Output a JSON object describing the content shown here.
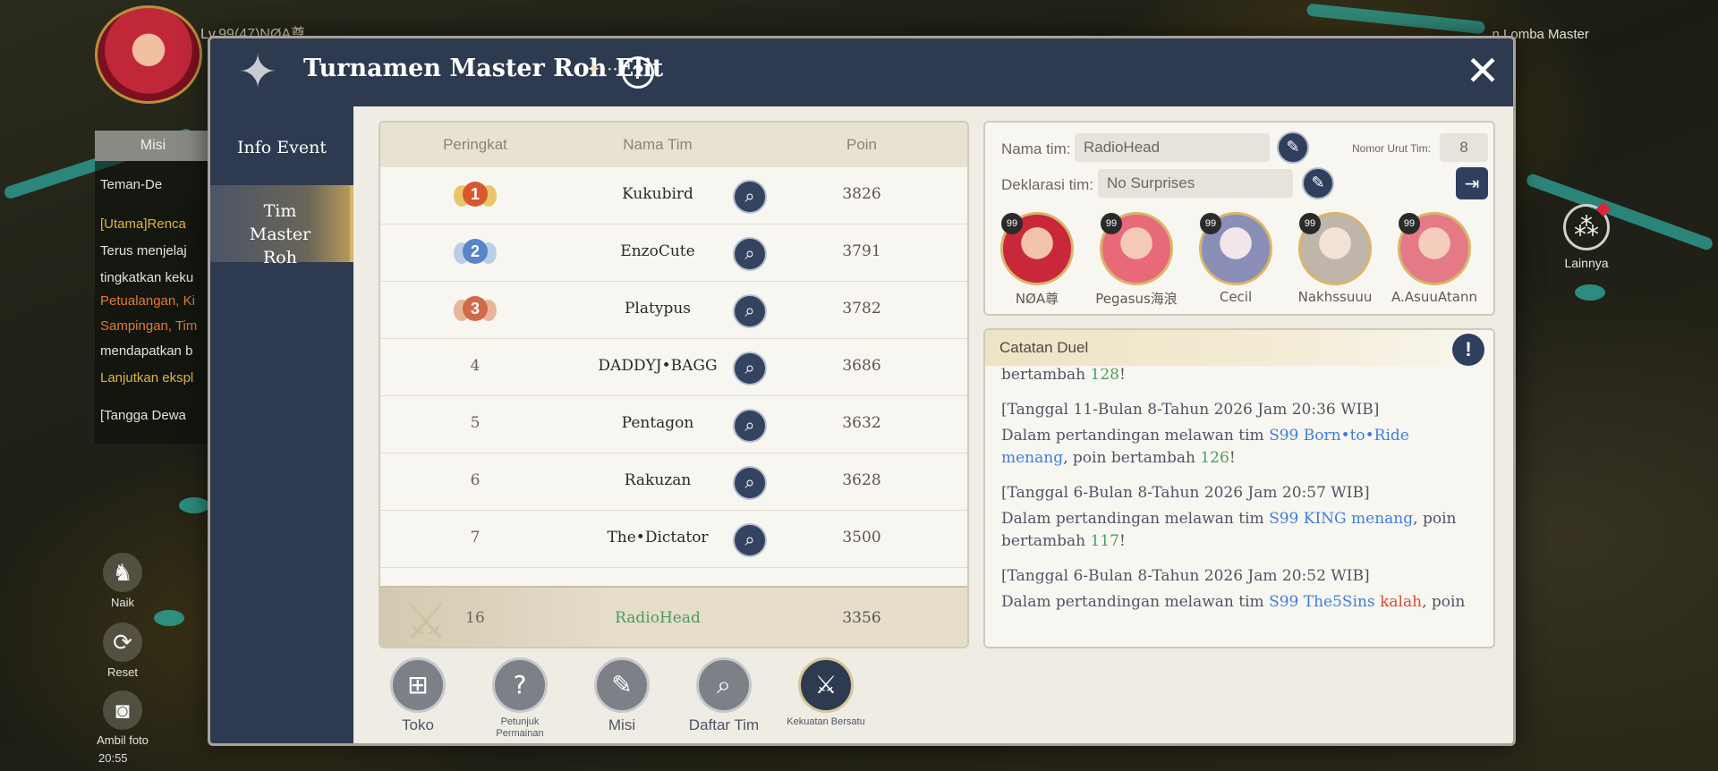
{
  "hud": {
    "level_text": "Lv.99(47)NØA尊",
    "tab_label": "Misi",
    "lines": [
      {
        "text": "Teman-De",
        "style": ""
      },
      {
        "text": "[Utama]Renca",
        "style": "gold"
      },
      {
        "text": "Terus menjelaj",
        "style": ""
      },
      {
        "text": "tingkatkan keku",
        "style": ""
      },
      {
        "text": "Petualangan, Ki",
        "style": "orange"
      },
      {
        "text": "Sampingan, Tim",
        "style": "orange"
      },
      {
        "text": "mendapatkan b",
        "style": ""
      },
      {
        "text": "Lanjutkan ekspl",
        "style": "gold"
      },
      {
        "text": "[Tangga Dewa",
        "style": ""
      }
    ],
    "side_buttons": [
      {
        "label": "Naik",
        "icon": "horse-icon"
      },
      {
        "label": "Reset",
        "icon": "camera-reset-icon"
      },
      {
        "label": "Ambil foto",
        "icon": "camera-icon"
      }
    ],
    "time": "20:55",
    "top_right": "...n Lomba Master",
    "lainnya_label": "Lainnya"
  },
  "dialog": {
    "title": "Turnamen Master Roh Elit",
    "nav": [
      {
        "label": "Info Event",
        "active": false
      },
      {
        "label": "Tim Master Roh",
        "active": true
      }
    ],
    "ranking": {
      "headers": {
        "rank": "Peringkat",
        "name": "Nama Tim",
        "points": "Poin"
      },
      "rows": [
        {
          "rank": "1",
          "name": "Kukubird",
          "points": "3826",
          "medal": "gold"
        },
        {
          "rank": "2",
          "name": "EnzoCute",
          "points": "3791",
          "medal": "silver"
        },
        {
          "rank": "3",
          "name": "Platypus",
          "points": "3782",
          "medal": "bronze"
        },
        {
          "rank": "4",
          "name": "DADDYJ•BAGG",
          "points": "3686",
          "medal": ""
        },
        {
          "rank": "5",
          "name": "Pentagon",
          "points": "3632",
          "medal": ""
        },
        {
          "rank": "6",
          "name": "Rakuzan",
          "points": "3628",
          "medal": ""
        },
        {
          "rank": "7",
          "name": "The•Dictator",
          "points": "3500",
          "medal": ""
        }
      ],
      "self": {
        "rank": "16",
        "name": "RadioHead",
        "points": "3356"
      }
    },
    "team": {
      "name_label": "Nama tim:",
      "name_value": "RadioHead",
      "number_label": "Nomor Urut Tim:",
      "number_value": "8",
      "declaration_label": "Deklarasi tim:",
      "declaration_value": "No Surprises",
      "members": [
        {
          "name": "NØA尊",
          "level": "99",
          "colors": [
            "#f2c3a8",
            "#c8283a"
          ]
        },
        {
          "name": "Pegasus海浪",
          "level": "99",
          "colors": [
            "#f4c9b8",
            "#e86a78"
          ]
        },
        {
          "name": "Cecil",
          "level": "99",
          "colors": [
            "#f1e6ea",
            "#8a8fb8"
          ]
        },
        {
          "name": "Nakhssuuu",
          "level": "99",
          "colors": [
            "#f3e3d6",
            "#bfb5aa"
          ]
        },
        {
          "name": "A.AsuuAtann",
          "level": "99",
          "colors": [
            "#f4cdbd",
            "#e47a86"
          ]
        }
      ]
    },
    "duel_log": {
      "title": "Catatan Duel",
      "top_fragment": {
        "prefix": "bertambah ",
        "points": "128",
        "suffix": "!"
      },
      "entries": [
        {
          "date": "[Tanggal 11-Bulan 8-Tahun 2026 Jam 20:36 WIB]",
          "lead": "Dalam pertandingan melawan tim ",
          "opponent": "S99 Born•to•Ride",
          "result": "menang",
          "result_type": "win",
          "middle": ", poin bertambah ",
          "points": "126",
          "tail": "!"
        },
        {
          "date": "[Tanggal 6-Bulan 8-Tahun 2026 Jam 20:57 WIB]",
          "lead": "Dalam pertandingan melawan tim ",
          "opponent": "S99 KING",
          "result": "menang",
          "result_type": "win",
          "middle": ", poin bertambah ",
          "points": "117",
          "tail": "!"
        },
        {
          "date": "[Tanggal 6-Bulan 8-Tahun 2026 Jam 20:52 WIB]",
          "lead": "Dalam pertandingan melawan tim ",
          "opponent": "S99 The5Sins",
          "result": "kalah",
          "result_type": "loss",
          "middle": ", poin",
          "points": "",
          "tail": ""
        }
      ]
    },
    "bottom_buttons": [
      {
        "label": "Toko",
        "icon": "shop-icon",
        "small": false
      },
      {
        "label": "Petunjuk Permainan",
        "icon": "question-book-icon",
        "small": true
      },
      {
        "label": "Misi",
        "icon": "mission-icon",
        "small": false
      },
      {
        "label": "Daftar Tim",
        "icon": "team-list-icon",
        "small": false
      },
      {
        "label": "Kekuatan Bersatu",
        "icon": "united-power-icon",
        "small": true
      }
    ]
  },
  "colors": {
    "navy": "#2d3a50",
    "win": "#3f7fd8",
    "loss": "#e0473a",
    "gain": "#4fa05e"
  }
}
